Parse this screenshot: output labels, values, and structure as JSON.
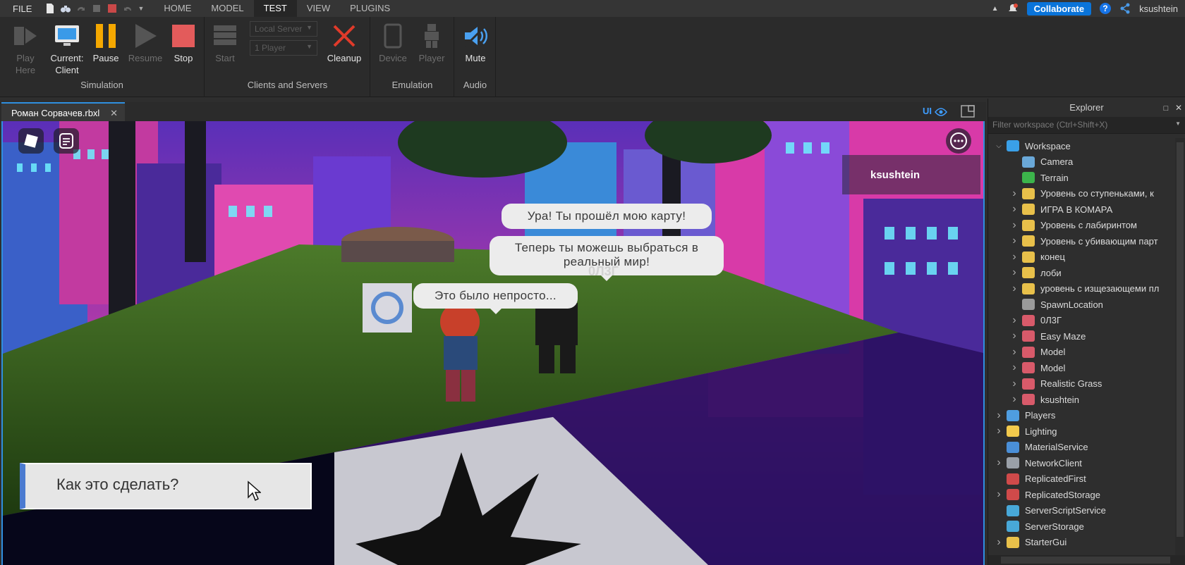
{
  "topbar": {
    "file": "FILE",
    "tabs": [
      "HOME",
      "MODEL",
      "TEST",
      "VIEW",
      "PLUGINS"
    ],
    "active_tab": "TEST",
    "collaborate": "Collaborate",
    "help": "?",
    "user": "ksushtein"
  },
  "ribbon": {
    "simulation": {
      "label": "Simulation",
      "play_here": "Play\nHere",
      "current_client": "Current:\nClient",
      "pause": "Pause",
      "resume": "Resume",
      "stop": "Stop"
    },
    "clients_servers": {
      "label": "Clients and Servers",
      "start": "Start",
      "server_select": "Local Server",
      "player_select": "1 Player",
      "cleanup": "Cleanup"
    },
    "emulation": {
      "label": "Emulation",
      "device": "Device",
      "player": "Player"
    },
    "audio": {
      "label": "Audio",
      "mute": "Mute"
    }
  },
  "document": {
    "tab": "Роман Сорвачев.rbxl",
    "ui_toggle": "UI"
  },
  "game": {
    "player_list_name": "ksushtein",
    "bubbles": [
      "Ура! Ты прошёл мою карту!",
      "Теперь ты можешь выбраться в реальный мир!",
      "Это было непросто..."
    ],
    "npc_name": "0Л3Г",
    "dialog_option": "Как это сделать?"
  },
  "explorer": {
    "title": "Explorer",
    "filter_placeholder": "Filter workspace (Ctrl+Shift+X)",
    "items": [
      {
        "label": "Workspace",
        "depth": 0,
        "arrow": "open",
        "icon": "globe-icon",
        "color": "#3aa0e8"
      },
      {
        "label": "Camera",
        "depth": 1,
        "arrow": "",
        "icon": "camera-icon",
        "color": "#6aa8d8"
      },
      {
        "label": "Terrain",
        "depth": 1,
        "arrow": "",
        "icon": "terrain-icon",
        "color": "#3cb44b"
      },
      {
        "label": "Уровень со ступеньками, к",
        "depth": 1,
        "arrow": "closed",
        "icon": "folder-icon",
        "color": "#e8c04a"
      },
      {
        "label": "ИГРА В КОМАРА",
        "depth": 1,
        "arrow": "closed",
        "icon": "folder-icon",
        "color": "#e8c04a"
      },
      {
        "label": "Уровень с лабиринтом",
        "depth": 1,
        "arrow": "closed",
        "icon": "folder-icon",
        "color": "#e8c04a"
      },
      {
        "label": "Уровень с убивающим парт",
        "depth": 1,
        "arrow": "closed",
        "icon": "folder-icon",
        "color": "#e8c04a"
      },
      {
        "label": "конец",
        "depth": 1,
        "arrow": "closed",
        "icon": "folder-icon",
        "color": "#e8c04a"
      },
      {
        "label": "лоби",
        "depth": 1,
        "arrow": "closed",
        "icon": "folder-icon",
        "color": "#e8c04a"
      },
      {
        "label": "уровень с изщезающеми пл",
        "depth": 1,
        "arrow": "closed",
        "icon": "folder-icon",
        "color": "#e8c04a"
      },
      {
        "label": "SpawnLocation",
        "depth": 1,
        "arrow": "",
        "icon": "spawn-icon",
        "color": "#9a9a9a"
      },
      {
        "label": "0Л3Г",
        "depth": 1,
        "arrow": "closed",
        "icon": "model-icon",
        "color": "#d85a6a"
      },
      {
        "label": "Easy Maze",
        "depth": 1,
        "arrow": "closed",
        "icon": "model-icon",
        "color": "#d85a6a"
      },
      {
        "label": "Model",
        "depth": 1,
        "arrow": "closed",
        "icon": "model-icon",
        "color": "#d85a6a"
      },
      {
        "label": "Model",
        "depth": 1,
        "arrow": "closed",
        "icon": "model-icon",
        "color": "#d85a6a"
      },
      {
        "label": "Realistic Grass",
        "depth": 1,
        "arrow": "closed",
        "icon": "model-icon",
        "color": "#d85a6a"
      },
      {
        "label": "ksushtein",
        "depth": 1,
        "arrow": "closed",
        "icon": "model-icon",
        "color": "#d85a6a"
      },
      {
        "label": "Players",
        "depth": 0,
        "arrow": "closed",
        "icon": "players-icon",
        "color": "#4f9de0"
      },
      {
        "label": "Lighting",
        "depth": 0,
        "arrow": "closed",
        "icon": "lightbulb-icon",
        "color": "#f2c94c"
      },
      {
        "label": "MaterialService",
        "depth": 0,
        "arrow": "",
        "icon": "material-icon",
        "color": "#4a8fd8"
      },
      {
        "label": "NetworkClient",
        "depth": 0,
        "arrow": "closed",
        "icon": "network-icon",
        "color": "#9aa0a8"
      },
      {
        "label": "ReplicatedFirst",
        "depth": 0,
        "arrow": "",
        "icon": "replicated-icon",
        "color": "#d04a4a"
      },
      {
        "label": "ReplicatedStorage",
        "depth": 0,
        "arrow": "closed",
        "icon": "replicated-icon",
        "color": "#d04a4a"
      },
      {
        "label": "ServerScriptService",
        "depth": 0,
        "arrow": "",
        "icon": "server-script-icon",
        "color": "#48a8d8"
      },
      {
        "label": "ServerStorage",
        "depth": 0,
        "arrow": "",
        "icon": "server-storage-icon",
        "color": "#48a8d8"
      },
      {
        "label": "StarterGui",
        "depth": 0,
        "arrow": "closed",
        "icon": "gui-icon",
        "color": "#e8c04a"
      }
    ]
  },
  "colors": {
    "accent": "#2f8fe0",
    "collaborate": "#0a74d9",
    "cleanup": "#e03a2a",
    "pause": "#f5a800",
    "stop": "#e35b5b"
  }
}
